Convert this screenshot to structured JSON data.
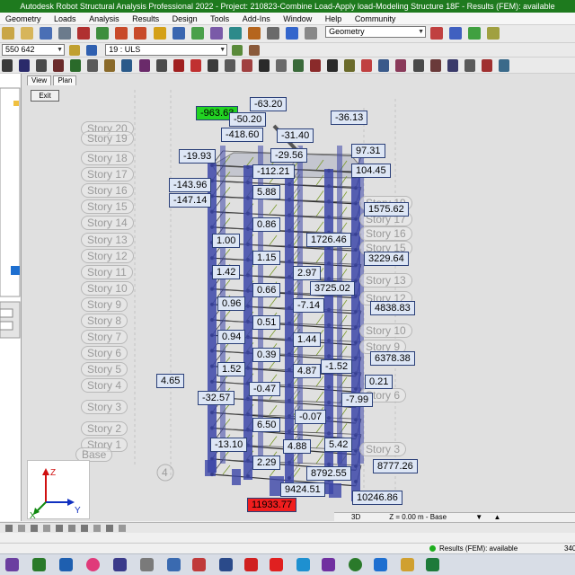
{
  "window": {
    "title": "Autodesk Robot Structural Analysis Professional 2022 - Project: 210823-Combine Load-Apply load-Modeling Structure 18F - Results (FEM): available"
  },
  "menu": [
    "Geometry",
    "Loads",
    "Analysis",
    "Results",
    "Design",
    "Tools",
    "Add-Ins",
    "Window",
    "Help",
    "Community"
  ],
  "toolbar": {
    "selection_field": "550 642",
    "case_field": "19 : ULS",
    "geometry_field": "Geometry"
  },
  "view": {
    "tabs": [
      "View",
      "Plan"
    ],
    "exit_label": "Exit",
    "mode_label": "3D",
    "z_label": "Z = 0.00 m - Base"
  },
  "stories": [
    "Story 20",
    "Story 19",
    "Story 18",
    "Story 17",
    "Story 16",
    "Story 15",
    "Story 14",
    "Story 13",
    "Story 12",
    "Story 11",
    "Story 10",
    "Story 9",
    "Story 8",
    "Story 7",
    "Story 6",
    "Story 5",
    "Story 4",
    "Story 3",
    "Story 2",
    "Story 1",
    "Base"
  ],
  "right_stories": [
    "Story 19",
    "Story 17",
    "Story 16",
    "Story 15",
    "Story 13",
    "Story 12",
    "Story 10",
    "Story 9",
    "Story 6",
    "Story 3"
  ],
  "grid_marker": "4",
  "result_values": [
    "-963.63",
    "-63.20",
    "-50.20",
    "-36.13",
    "-418.60",
    "-31.40",
    "-19.93",
    "-29.56",
    "97.31",
    "-112.21",
    "104.45",
    "-143.96",
    "5.88",
    "-147.14",
    "1575.62",
    "0.86",
    "1.00",
    "1726.46",
    "1.15",
    "3229.64",
    "1.42",
    "2.97",
    "3725.02",
    "0.66",
    "0.96",
    "-7.14",
    "4838.83",
    "0.51",
    "0.94",
    "1.44",
    "0.39",
    "6378.38",
    "1.52",
    "4.87",
    "-1.52",
    "4.65",
    "-0.47",
    "0.21",
    "-32.57",
    "-7.99",
    "-0.07",
    "6.50",
    "-13.10",
    "4.88",
    "5.42",
    "2.29",
    "8792.55",
    "8777.26",
    "9424.51",
    "10246.86",
    "11933.77"
  ],
  "status": {
    "results_text": "Results (FEM): available",
    "right_value": "340"
  },
  "colors": {
    "title_bar": "#1e7a1e",
    "label_fill": "#dde6f5",
    "label_highlight_min": "#22d322",
    "label_highlight_max": "#f01e1e",
    "column_color": "#3c46a8"
  }
}
